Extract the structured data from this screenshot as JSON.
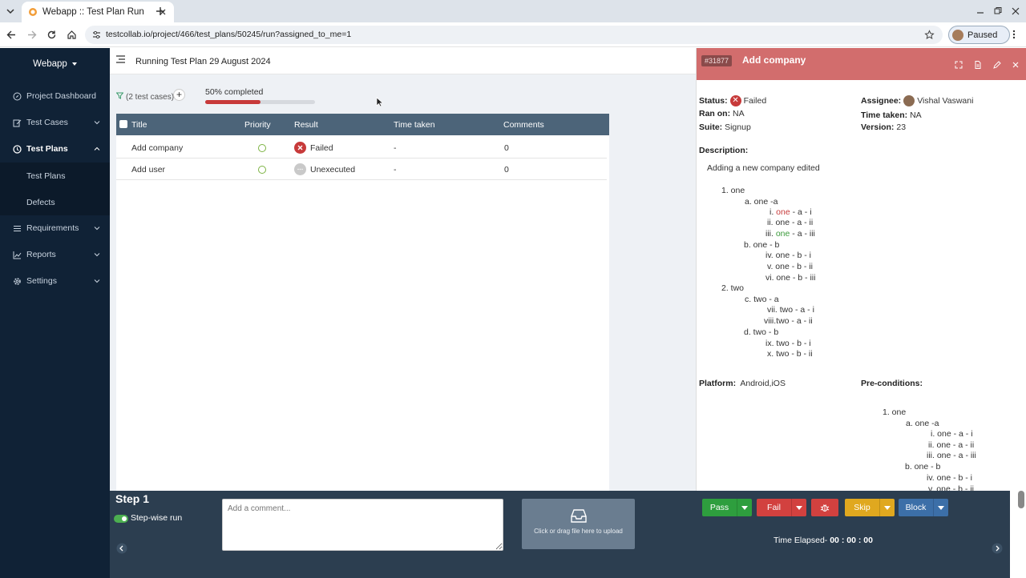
{
  "browser": {
    "tab_title": "Webapp :: Test Plan Run",
    "url": "testcollab.io/project/466/test_plans/50245/run?assigned_to_me=1",
    "profile_label": "Paused"
  },
  "sidebar": {
    "workspace": "Webapp",
    "items": [
      {
        "label": "Project Dashboard",
        "icon": "compass-icon"
      },
      {
        "label": "Test Cases",
        "icon": "edit-icon"
      },
      {
        "label": "Test Plans",
        "icon": "clock-icon"
      },
      {
        "label": "Requirements",
        "icon": "list-icon"
      },
      {
        "label": "Reports",
        "icon": "chart-icon"
      },
      {
        "label": "Settings",
        "icon": "gear-icon"
      }
    ],
    "subitems": [
      "Test Plans",
      "Defects"
    ]
  },
  "main": {
    "run_title": "Running Test Plan 29 August 2024",
    "test_case_count": "(2 test cases)",
    "progress_label": "50% completed",
    "progress_fraction": 0.5,
    "columns": [
      "Title",
      "Priority",
      "Result",
      "Time taken",
      "Comments"
    ],
    "rows": [
      {
        "title": "Add company",
        "result": "Failed",
        "time": "-",
        "comments": "0"
      },
      {
        "title": "Add user",
        "result": "Unexecuted",
        "time": "-",
        "comments": "0"
      }
    ]
  },
  "panel": {
    "case_id": "#31877",
    "case_title": "Add company",
    "status_label": "Status:",
    "status": "Failed",
    "ran_on_label": "Ran on:",
    "ran_on": "NA",
    "suite_label": "Suite:",
    "suite": "Signup",
    "assignee_label": "Assignee:",
    "assignee": "Vishal Vaswani",
    "time_taken_label": "Time taken:",
    "time_taken": "NA",
    "version_label": "Version:",
    "version": "23",
    "description_label": "Description:",
    "description_text": "Adding a new company edited",
    "platform_label": "Platform:",
    "platform": "Android,iOS",
    "preconditions_label": "Pre-conditions:",
    "outline": [
      "1. one",
      "a. one -a",
      "i.",
      "one",
      " - a - i",
      "ii.",
      "one",
      " - a - ii",
      "iii.",
      "one",
      " - a - iii",
      "b. one - b",
      "iv. one - b - i",
      "v. one - b - ii",
      "vi. one - b - iii",
      "2. two",
      "c. two - a",
      "vii. two - a - i",
      "viii.two - a - ii",
      "d. two - b",
      "ix. two - b - i",
      "x. two - b - ii"
    ],
    "pre_outline": [
      "1. one",
      "a. one -a",
      "i. one - a - i",
      "ii. one - a - ii",
      "iii. one - a - iii",
      "b. one - b",
      "iv. one - b - i",
      "v. one - b - ii"
    ]
  },
  "bottom": {
    "step": "Step 1",
    "stepwise_label": "Step-wise run",
    "comment_placeholder": "Add a comment...",
    "upload_text": "Click or drag file here to upload",
    "pass": "Pass",
    "fail": "Fail",
    "skip": "Skip",
    "block": "Block",
    "elapsed_label": "Time Elapsed- ",
    "elapsed_value": "00 : 00 : 00"
  },
  "colors": {
    "sidebar_bg": "#102236",
    "panel_header": "#d26d6d",
    "failed": "#c73a3a",
    "pass": "#2e9e3e",
    "fail": "#d2413f",
    "skip": "#e0a81f",
    "block": "#3c6fa8"
  }
}
